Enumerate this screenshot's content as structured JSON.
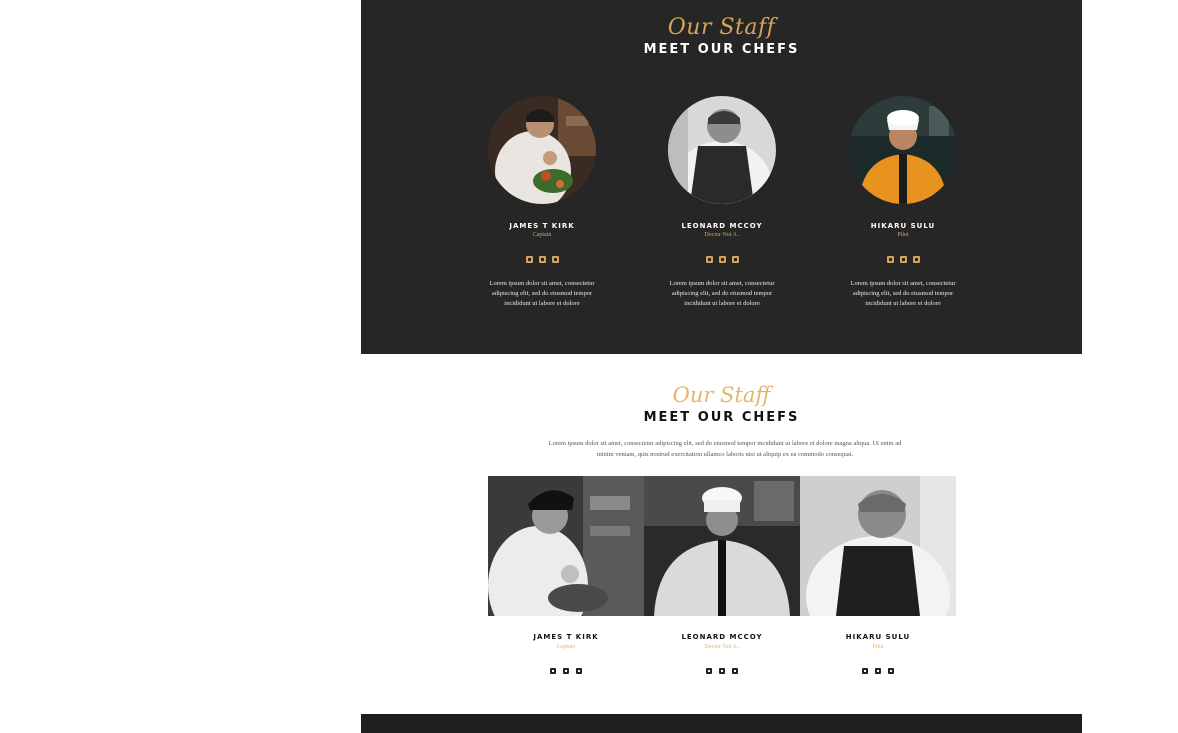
{
  "colors": {
    "dark_bg": "#262626",
    "gold": "#d6a457",
    "light_gold": "#e5b56c",
    "white": "#ffffff",
    "ink": "#111111"
  },
  "dark_section": {
    "script_title": "Our Staff",
    "title": "MEET OUR CHEFS",
    "chefs": [
      {
        "name": "JAMES T KIRK",
        "role": "Captain",
        "photo_icon": "chef-plating-photo",
        "social": [
          "facebook-icon",
          "linkedin-icon",
          "instagram-icon"
        ],
        "bio": "Lorem ipsum dolor sit amet, consectetur adipiscing elit, sed do eiusmod tempor incididunt ut labore et dolore"
      },
      {
        "name": "LEONARD MCCOY",
        "role": "Doctor Not A .",
        "photo_icon": "chef-apron-photo",
        "social": [
          "facebook-icon",
          "linkedin-icon",
          "instagram-icon"
        ],
        "bio": "Lorem ipsum dolor sit amet, consectetur adipiscing elit, sed do eiusmod tempor incididunt ut labore et dolore"
      },
      {
        "name": "HIKARU SULU",
        "role": "Pilot",
        "photo_icon": "chef-orange-jacket-photo",
        "social": [
          "facebook-icon",
          "linkedin-icon",
          "instagram-icon"
        ],
        "bio": "Lorem ipsum dolor sit amet, consectetur adipiscing elit, sed do eiusmod tempor incididunt ut labore et dolore"
      }
    ]
  },
  "light_section": {
    "script_title": "Our Staff",
    "title": "MEET OUR CHEFS",
    "intro": "Lorem ipsum dolor sit amet, consectetur adipiscing elit, sed do eiusmod tempor incididunt ut labore et dolore magna aliqua. Ut enim ad minim veniam, quis nostrud exercitation ullamco laboris nisi ut aliquip ex ea commodo consequat.",
    "chefs": [
      {
        "name": "JAMES T KIRK",
        "role": "Captain",
        "photo_icon": "chef-plating-bw-photo",
        "social": [
          "facebook-icon",
          "linkedin-icon",
          "instagram-icon"
        ]
      },
      {
        "name": "LEONARD MCCOY",
        "role": "Doctor Not A .",
        "photo_icon": "chef-white-jacket-bw-photo",
        "social": [
          "facebook-icon",
          "linkedin-icon",
          "instagram-icon"
        ]
      },
      {
        "name": "HIKARU SULU",
        "role": "Pilot",
        "photo_icon": "chef-apron-bw-photo",
        "social": [
          "facebook-icon",
          "linkedin-icon",
          "instagram-icon"
        ]
      }
    ]
  }
}
